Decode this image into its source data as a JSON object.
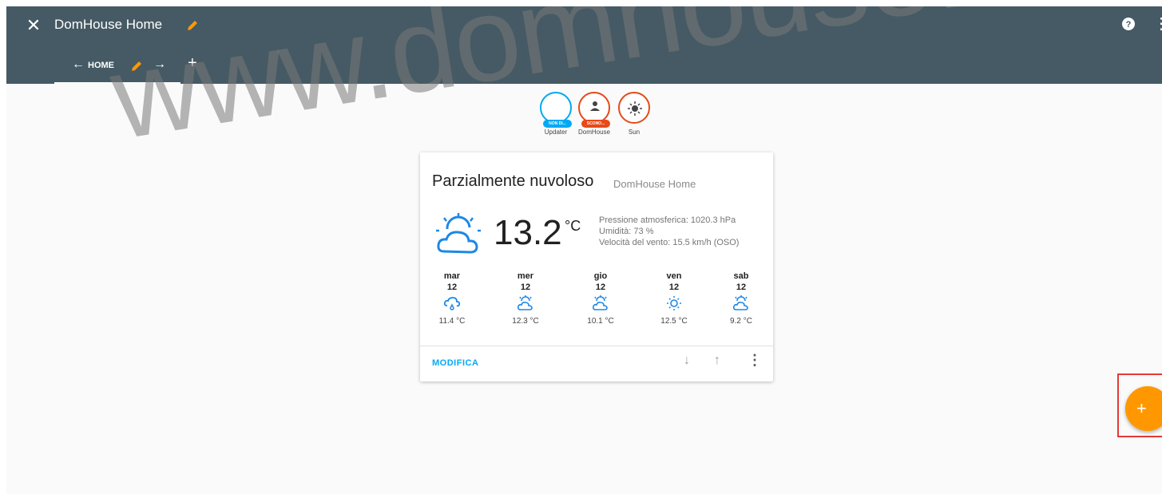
{
  "toolbar": {
    "title": "DomHouse Home",
    "tab_label": "HOME"
  },
  "badges": [
    {
      "name": "Updater",
      "state": "NON DI...",
      "color": "#03a9f4"
    },
    {
      "name": "DomHouse",
      "state": "SCONO...",
      "color": "#e64a19"
    },
    {
      "name": "Sun",
      "state": "",
      "color": "#e64a19"
    }
  ],
  "weather": {
    "condition": "Parzialmente nuvoloso",
    "location": "DomHouse Home",
    "temperature": "13.2",
    "unit": "°C",
    "pressure": "Pressione atmosferica: 1020.3 hPa",
    "humidity": "Umidità: 73 %",
    "wind": "Velocità del vento: 15.5 km/h (OSO)",
    "forecast": [
      {
        "day": "mar",
        "date": "12",
        "icon": "rain-cloud-icon",
        "temp": "11.4 °C"
      },
      {
        "day": "mer",
        "date": "12",
        "icon": "partly-cloudy-icon",
        "temp": "12.3 °C"
      },
      {
        "day": "gio",
        "date": "12",
        "icon": "partly-cloudy-icon",
        "temp": "10.1 °C"
      },
      {
        "day": "ven",
        "date": "12",
        "icon": "sun-icon",
        "temp": "12.5 °C"
      },
      {
        "day": "sab",
        "date": "12",
        "icon": "partly-cloudy-icon",
        "temp": "9.2 °C"
      }
    ],
    "edit_label": "MODIFICA"
  },
  "watermark": "www.domhouse.it",
  "colors": {
    "toolbar": "#455a64",
    "accent": "#ff9800",
    "link": "#03a9f4",
    "highlight": "#e53935"
  }
}
